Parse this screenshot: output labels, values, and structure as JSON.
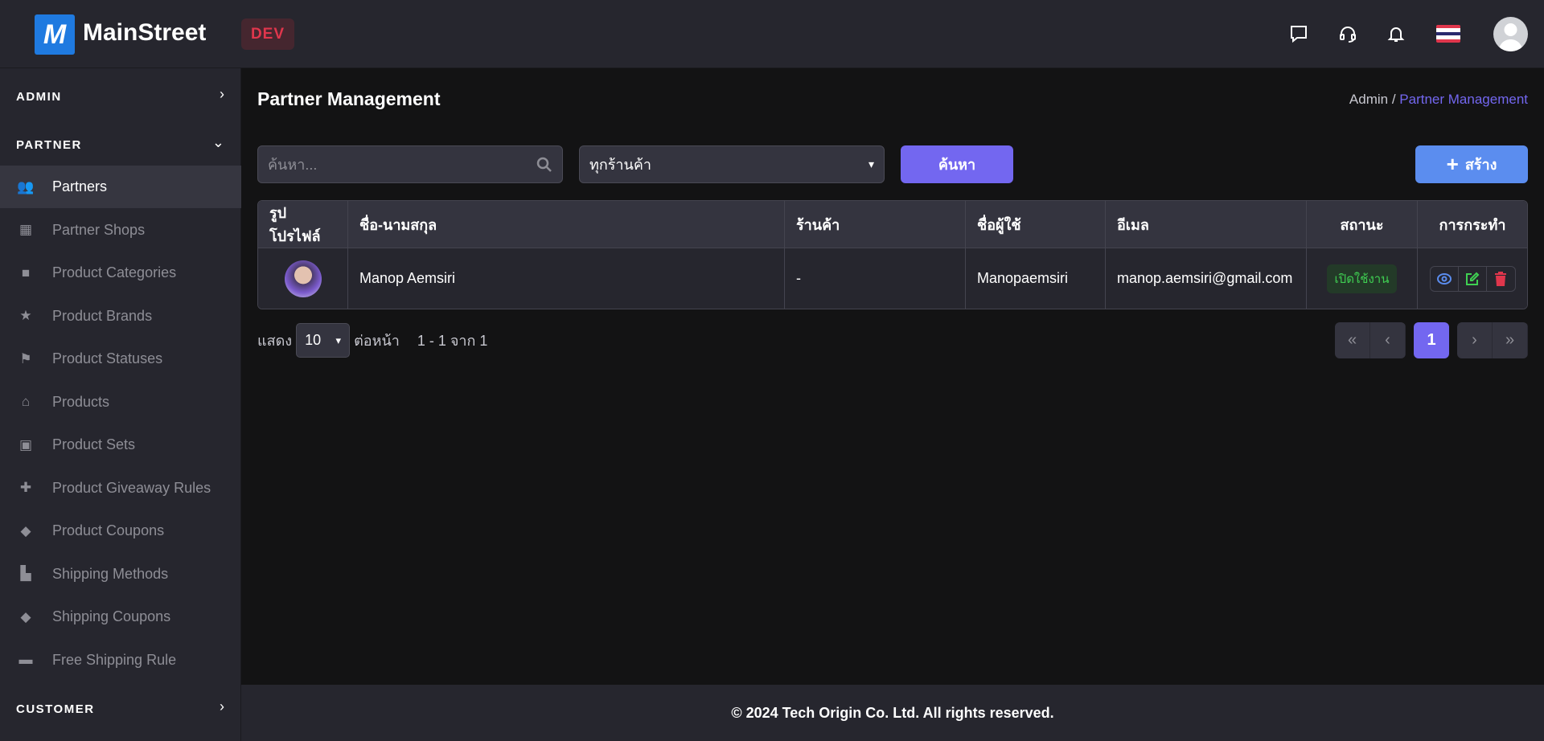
{
  "header": {
    "brand": "MainStreet",
    "env_badge": "DEV",
    "icons": [
      "chat-icon",
      "headset-icon",
      "bell-icon",
      "thai-flag-icon",
      "user-avatar"
    ]
  },
  "sidebar": {
    "sections": [
      {
        "label": "ADMIN",
        "expanded": false
      },
      {
        "label": "PARTNER",
        "expanded": true
      },
      {
        "label": "CUSTOMER",
        "expanded": false
      }
    ],
    "items": [
      {
        "label": "Partners",
        "icon": "users-icon",
        "active": true
      },
      {
        "label": "Partner Shops",
        "icon": "store-icon"
      },
      {
        "label": "Product Categories",
        "icon": "box-icon"
      },
      {
        "label": "Product Brands",
        "icon": "star-icon"
      },
      {
        "label": "Product Statuses",
        "icon": "flag-icon"
      },
      {
        "label": "Products",
        "icon": "basket-icon"
      },
      {
        "label": "Product Sets",
        "icon": "bag-icon"
      },
      {
        "label": "Product Giveaway Rules",
        "icon": "gift-icon"
      },
      {
        "label": "Product Coupons",
        "icon": "tags-icon"
      },
      {
        "label": "Shipping Methods",
        "icon": "dolly-icon"
      },
      {
        "label": "Shipping Coupons",
        "icon": "tags-icon"
      },
      {
        "label": "Free Shipping Rule",
        "icon": "truck-icon"
      }
    ]
  },
  "page": {
    "title": "Partner Management",
    "breadcrumb": {
      "root": "Admin",
      "sep": "/",
      "current": "Partner Management"
    }
  },
  "filters": {
    "search_placeholder": "ค้นหา...",
    "shop_select": "ทุกร้านค้า",
    "search_button": "ค้นหา",
    "create_button": "สร้าง"
  },
  "table": {
    "columns": [
      "รูปโปรไฟล์",
      "ชื่อ-นามสกุล",
      "ร้านค้า",
      "ชื่อผู้ใช้",
      "อีเมล",
      "สถานะ",
      "การกระทำ"
    ],
    "rows": [
      {
        "name": "Manop Aemsiri",
        "shop": "-",
        "username": "Manopaemsiri",
        "email": "manop.aemsiri@gmail.com",
        "status": "เปิดใช้งาน"
      }
    ]
  },
  "pagination": {
    "show_label": "แสดง",
    "per_page": "10",
    "per_page_suffix": "ต่อหน้า",
    "range": "1 - 1 จาก 1",
    "current_page": "1",
    "first": "«",
    "prev": "‹",
    "next": "›",
    "last": "»"
  },
  "footer": {
    "text": "© 2024 Tech Origin Co. Ltd. All rights reserved."
  },
  "colors": {
    "accent": "#7367f0",
    "create": "#5b8def",
    "status_active": "#3fcf52",
    "delete": "#e0364c"
  }
}
